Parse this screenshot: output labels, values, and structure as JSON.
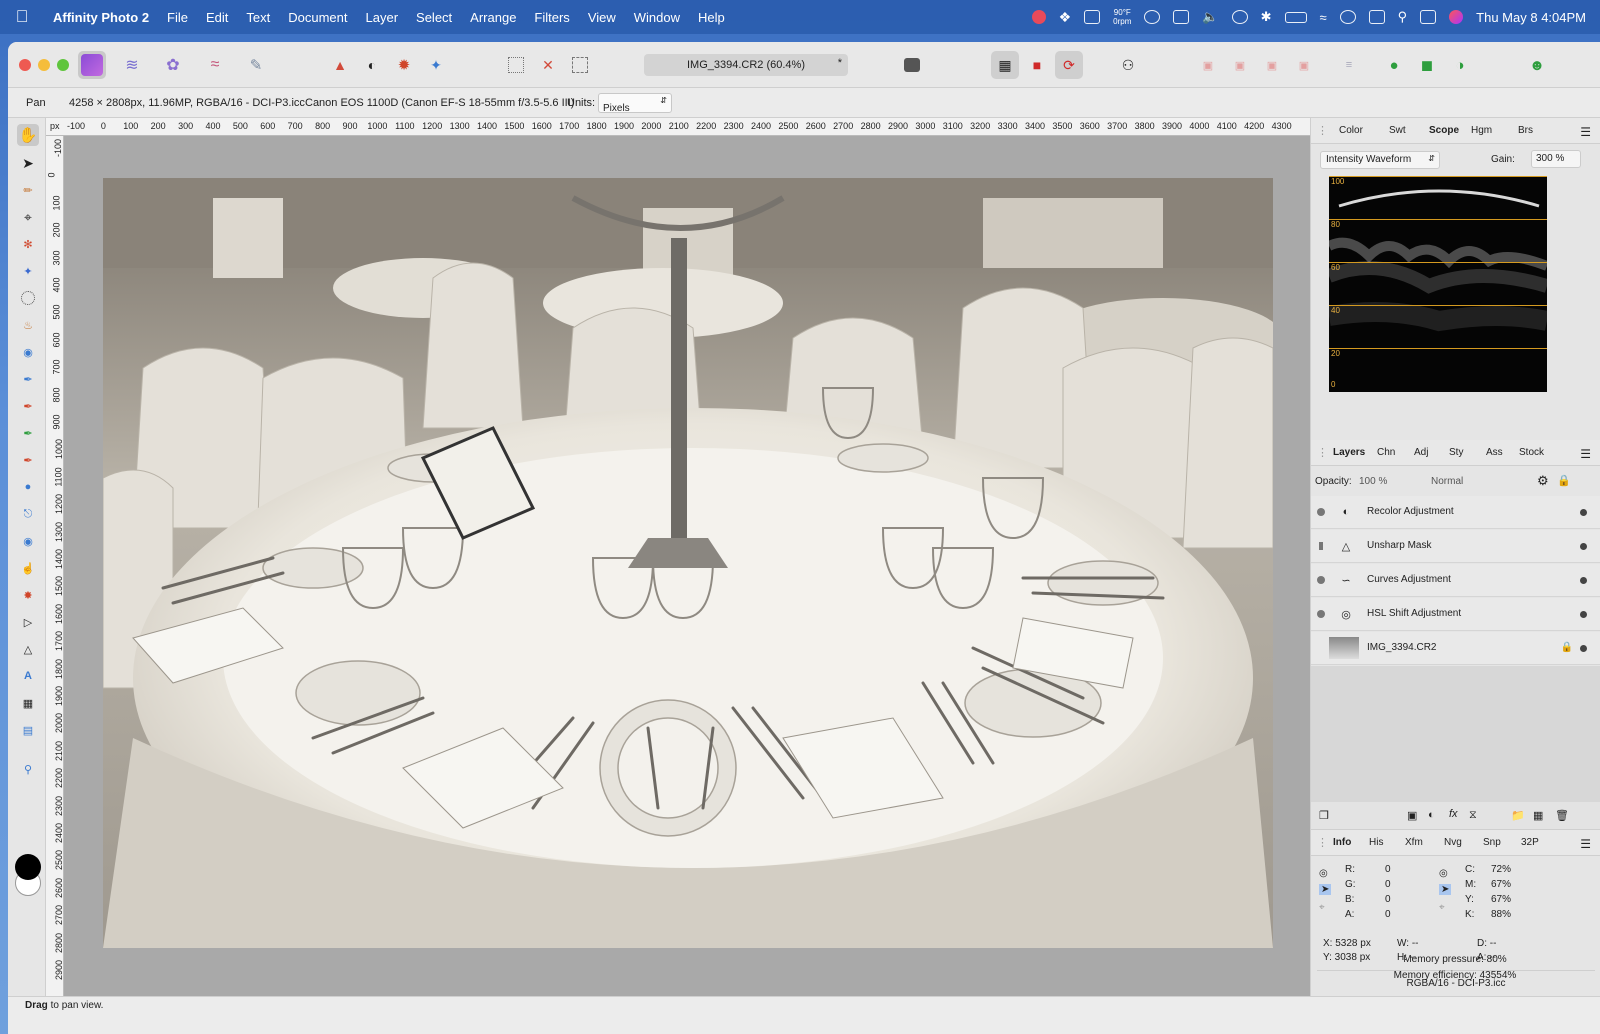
{
  "menubar": {
    "app_name": "Affinity Photo 2",
    "items": [
      "File",
      "Edit",
      "Text",
      "Document",
      "Layer",
      "Select",
      "Arrange",
      "Filters",
      "View",
      "Window",
      "Help"
    ],
    "weather_temp": "90°F",
    "weather_rpm": "0rpm",
    "clock": "Thu May 8  4:04PM"
  },
  "document": {
    "tab_title": "IMG_3394.CR2 (60.4%)",
    "modified_mark": "*"
  },
  "context": {
    "tool": "Pan",
    "image_info": "4258 × 2808px, 11.96MP, RGBA/16 - DCI-P3.icc",
    "camera": "Canon EOS 1100D (Canon EF-S 18-55mm f/3.5-5.6 III)",
    "units_label": "Units:",
    "units_value": "Pixels"
  },
  "ruler": {
    "unit": "px",
    "h_ticks": [
      "-100",
      "0",
      "100",
      "200",
      "300",
      "400",
      "500",
      "600",
      "700",
      "800",
      "900",
      "1000",
      "1100",
      "1200",
      "1300",
      "1400",
      "1500",
      "1600",
      "1700",
      "1800",
      "1900",
      "2000",
      "2100",
      "2200",
      "2300",
      "2400",
      "2500",
      "2600",
      "2700",
      "2800",
      "2900",
      "3000",
      "3100",
      "3200",
      "3300",
      "3400",
      "3500",
      "3600",
      "3700",
      "3800",
      "3900",
      "4000",
      "4100",
      "4200",
      "4300"
    ],
    "v_ticks": [
      "-100",
      "0",
      "100",
      "200",
      "300",
      "400",
      "500",
      "600",
      "700",
      "800",
      "900",
      "1000",
      "1100",
      "1200",
      "1300",
      "1400",
      "1500",
      "1600",
      "1700",
      "1800",
      "1900",
      "2000",
      "2100",
      "2200",
      "2300",
      "2400",
      "2500",
      "2600",
      "2700",
      "2800",
      "2900"
    ]
  },
  "scope_panel": {
    "tabs": [
      "Color",
      "Swt",
      "Scope",
      "Hgm",
      "Brs"
    ],
    "active": "Scope",
    "mode": "Intensity Waveform",
    "gain_label": "Gain:",
    "gain_value": "300 %",
    "scale": [
      "100",
      "80",
      "60",
      "40",
      "20",
      "0"
    ]
  },
  "layers_panel": {
    "tabs": [
      "Layers",
      "Chn",
      "Adj",
      "Sty",
      "Ass",
      "Stock"
    ],
    "active": "Layers",
    "opacity_label": "Opacity:",
    "opacity_value": "100 %",
    "blend_mode": "Normal",
    "layers": [
      {
        "name": "Recolor Adjustment",
        "icon": "recolor-icon"
      },
      {
        "name": "Unsharp Mask",
        "icon": "unsharp-mask-icon"
      },
      {
        "name": "Curves Adjustment",
        "icon": "curves-icon"
      },
      {
        "name": "HSL Shift Adjustment",
        "icon": "hsl-icon"
      },
      {
        "name": "IMG_3394.CR2",
        "icon": "image-thumbnail"
      }
    ]
  },
  "info_panel": {
    "tabs": [
      "Info",
      "His",
      "Xfm",
      "Nvg",
      "Snp",
      "32P"
    ],
    "active": "Info",
    "rgba": [
      {
        "k": "R:",
        "v": "0"
      },
      {
        "k": "G:",
        "v": "0"
      },
      {
        "k": "B:",
        "v": "0"
      },
      {
        "k": "A:",
        "v": "0"
      }
    ],
    "cmyk": [
      {
        "k": "C:",
        "v": "72%"
      },
      {
        "k": "M:",
        "v": "67%"
      },
      {
        "k": "Y:",
        "v": "67%"
      },
      {
        "k": "K:",
        "v": "88%"
      }
    ],
    "x": "X: 5328 px",
    "y": "Y: 3038 px",
    "w": "W: --",
    "h": "H: --",
    "d": "D: --",
    "a": "A: --",
    "profile": "RGBA/16 - DCI-P3.icc",
    "memory_pressure": "Memory pressure: 80%",
    "memory_efficiency": "Memory efficiency: 43554%"
  },
  "status": {
    "bold": "Drag",
    "rest": " to pan view."
  }
}
